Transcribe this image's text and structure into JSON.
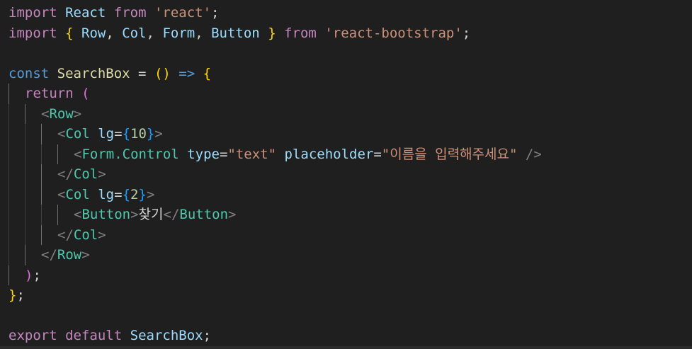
{
  "editor": {
    "language": "javascript-jsx",
    "theme_colors": {
      "background": "#1f1f1f",
      "keyword_control": "#c586c0",
      "keyword": "#569cd6",
      "identifier": "#9cdcfe",
      "component": "#4ec9b0",
      "string": "#ce9178",
      "number": "#b5cea8",
      "bracket_level_1": "#ffd700",
      "bracket_level_2": "#da70d6",
      "bracket_level_3": "#179fff",
      "tag_bracket": "#808080"
    },
    "lines": [
      [
        {
          "t": "import",
          "c": "kw-ctrl"
        },
        {
          "t": " ",
          "c": "punc"
        },
        {
          "t": "React",
          "c": "ident"
        },
        {
          "t": " ",
          "c": "punc"
        },
        {
          "t": "from",
          "c": "kw-ctrl"
        },
        {
          "t": " ",
          "c": "punc"
        },
        {
          "t": "'react'",
          "c": "str"
        },
        {
          "t": ";",
          "c": "punc"
        }
      ],
      [
        {
          "t": "import",
          "c": "kw-ctrl"
        },
        {
          "t": " ",
          "c": "punc"
        },
        {
          "t": "{",
          "c": "b1"
        },
        {
          "t": " ",
          "c": "punc"
        },
        {
          "t": "Row",
          "c": "ident"
        },
        {
          "t": ", ",
          "c": "punc"
        },
        {
          "t": "Col",
          "c": "ident"
        },
        {
          "t": ", ",
          "c": "punc"
        },
        {
          "t": "Form",
          "c": "ident"
        },
        {
          "t": ", ",
          "c": "punc"
        },
        {
          "t": "Button",
          "c": "ident"
        },
        {
          "t": " ",
          "c": "punc"
        },
        {
          "t": "}",
          "c": "b1"
        },
        {
          "t": " ",
          "c": "punc"
        },
        {
          "t": "from",
          "c": "kw-ctrl"
        },
        {
          "t": " ",
          "c": "punc"
        },
        {
          "t": "'react-bootstrap'",
          "c": "str"
        },
        {
          "t": ";",
          "c": "punc"
        }
      ],
      [],
      [
        {
          "t": "const",
          "c": "kw"
        },
        {
          "t": " ",
          "c": "punc"
        },
        {
          "t": "SearchBox",
          "c": "func"
        },
        {
          "t": " = ",
          "c": "punc"
        },
        {
          "t": "()",
          "c": "b1"
        },
        {
          "t": " ",
          "c": "punc"
        },
        {
          "t": "=>",
          "c": "kw"
        },
        {
          "t": " ",
          "c": "punc"
        },
        {
          "t": "{",
          "c": "b1"
        }
      ],
      [
        {
          "indent": 1
        },
        {
          "t": "return",
          "c": "kw-ctrl"
        },
        {
          "t": " ",
          "c": "punc"
        },
        {
          "t": "(",
          "c": "b2"
        }
      ],
      [
        {
          "indent": 2
        },
        {
          "t": "<",
          "c": "tagbr"
        },
        {
          "t": "Row",
          "c": "cls"
        },
        {
          "t": ">",
          "c": "tagbr"
        }
      ],
      [
        {
          "indent": 3
        },
        {
          "t": "<",
          "c": "tagbr"
        },
        {
          "t": "Col",
          "c": "cls"
        },
        {
          "t": " ",
          "c": "punc"
        },
        {
          "t": "lg",
          "c": "ident"
        },
        {
          "t": "=",
          "c": "punc"
        },
        {
          "t": "{",
          "c": "b3"
        },
        {
          "t": "10",
          "c": "num"
        },
        {
          "t": "}",
          "c": "b3"
        },
        {
          "t": ">",
          "c": "tagbr"
        }
      ],
      [
        {
          "indent": 4
        },
        {
          "t": "<",
          "c": "tagbr"
        },
        {
          "t": "Form.Control",
          "c": "cls"
        },
        {
          "t": " ",
          "c": "punc"
        },
        {
          "t": "type",
          "c": "ident"
        },
        {
          "t": "=",
          "c": "punc"
        },
        {
          "t": "\"text\"",
          "c": "str"
        },
        {
          "t": " ",
          "c": "punc"
        },
        {
          "t": "placeholder",
          "c": "ident"
        },
        {
          "t": "=",
          "c": "punc"
        },
        {
          "t": "\"이름을 입력해주세요\"",
          "c": "str"
        },
        {
          "t": " ",
          "c": "punc"
        },
        {
          "t": "/>",
          "c": "tagbr"
        }
      ],
      [
        {
          "indent": 3
        },
        {
          "t": "</",
          "c": "tagbr"
        },
        {
          "t": "Col",
          "c": "cls"
        },
        {
          "t": ">",
          "c": "tagbr"
        }
      ],
      [
        {
          "indent": 3
        },
        {
          "t": "<",
          "c": "tagbr"
        },
        {
          "t": "Col",
          "c": "cls"
        },
        {
          "t": " ",
          "c": "punc"
        },
        {
          "t": "lg",
          "c": "ident"
        },
        {
          "t": "=",
          "c": "punc"
        },
        {
          "t": "{",
          "c": "b3"
        },
        {
          "t": "2",
          "c": "num"
        },
        {
          "t": "}",
          "c": "b3"
        },
        {
          "t": ">",
          "c": "tagbr"
        }
      ],
      [
        {
          "indent": 4
        },
        {
          "t": "<",
          "c": "tagbr"
        },
        {
          "t": "Button",
          "c": "cls"
        },
        {
          "t": ">",
          "c": "tagbr"
        },
        {
          "t": "찾기",
          "c": "jsx-text"
        },
        {
          "t": "</",
          "c": "tagbr"
        },
        {
          "t": "Button",
          "c": "cls"
        },
        {
          "t": ">",
          "c": "tagbr"
        }
      ],
      [
        {
          "indent": 3
        },
        {
          "t": "</",
          "c": "tagbr"
        },
        {
          "t": "Col",
          "c": "cls"
        },
        {
          "t": ">",
          "c": "tagbr"
        }
      ],
      [
        {
          "indent": 2
        },
        {
          "t": "</",
          "c": "tagbr"
        },
        {
          "t": "Row",
          "c": "cls"
        },
        {
          "t": ">",
          "c": "tagbr"
        }
      ],
      [
        {
          "indent": 1
        },
        {
          "t": ")",
          "c": "b2"
        },
        {
          "t": ";",
          "c": "punc"
        }
      ],
      [
        {
          "t": "}",
          "c": "b1"
        },
        {
          "t": ";",
          "c": "punc"
        }
      ],
      [],
      [
        {
          "t": "export",
          "c": "kw-ctrl"
        },
        {
          "t": " ",
          "c": "punc"
        },
        {
          "t": "default",
          "c": "kw-ctrl"
        },
        {
          "t": " ",
          "c": "punc"
        },
        {
          "t": "SearchBox",
          "c": "ident"
        },
        {
          "t": ";",
          "c": "punc"
        }
      ]
    ]
  }
}
